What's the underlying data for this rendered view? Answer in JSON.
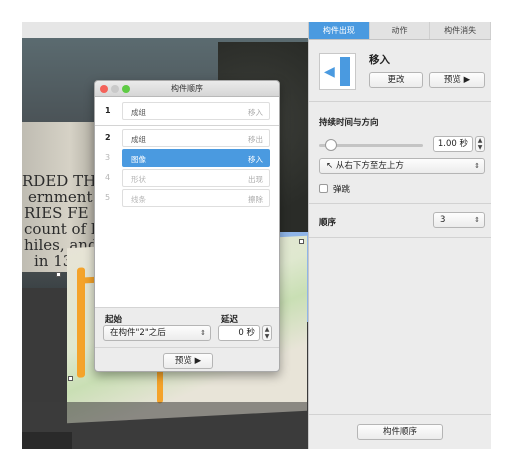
{
  "inspector": {
    "tabs": [
      "构件出现",
      "动作",
      "构件消失"
    ],
    "effect_name": "移入",
    "change_label": "更改",
    "preview_label": "预览 ▶",
    "duration_heading": "持续时间与方向",
    "duration_value": "1.00 秒",
    "direction_value": "从右下方至左上方",
    "bounce_label": "弹跳",
    "order_label": "顺序",
    "order_value": "3",
    "build_order_button": "构件顺序",
    "accent_color": "#4a9ae0"
  },
  "dialog": {
    "title": "构件顺序",
    "rows": [
      {
        "num": "1",
        "name": "成组",
        "effect": "移入"
      },
      {
        "num": "2",
        "name": "成组",
        "effect": "移出"
      },
      {
        "num": "3",
        "name": "图像",
        "effect": "移入"
      },
      {
        "num": "4",
        "name": "形状",
        "effect": "出现"
      },
      {
        "num": "5",
        "name": "线条",
        "effect": "擦除"
      }
    ],
    "start_label": "起始",
    "start_value": "在构件\"2\"之后",
    "delay_label": "延迟",
    "delay_value": "0 秒",
    "preview_label": "预览 ▶"
  },
  "slide": {
    "engraving_lines": [
      "RDED THI",
      "ernment",
      "RIES FE",
      "count of h",
      "hiles, and",
      "in 13"
    ]
  }
}
